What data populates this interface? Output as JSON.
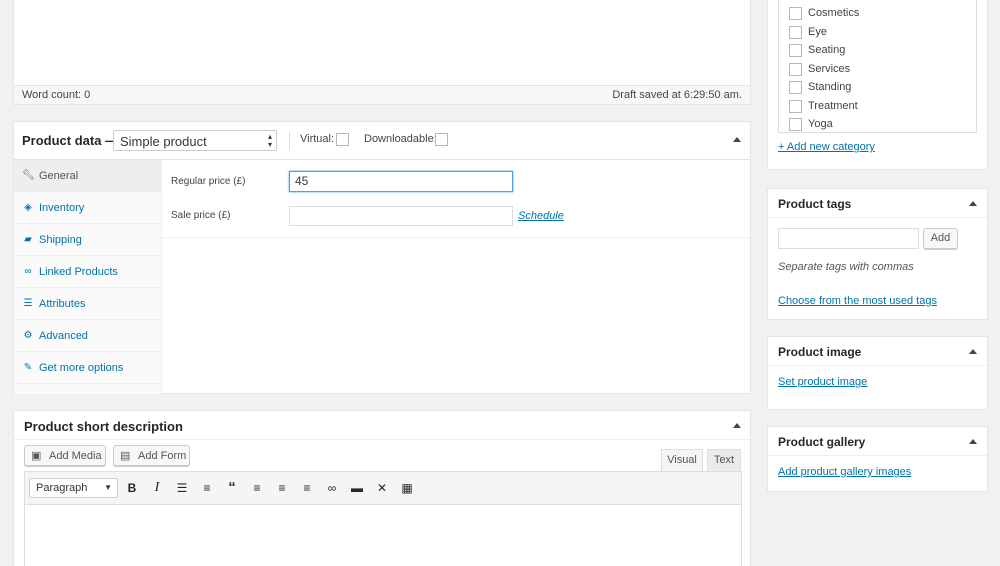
{
  "editor": {
    "word_count": "Word count: 0",
    "draft_saved": "Draft saved at 6:29:50 am."
  },
  "product_data": {
    "title": "Product data —",
    "type_select": "Simple product",
    "virtual_label": "Virtual:",
    "downloadable_label": "Downloadable:",
    "tabs": [
      {
        "label": "General",
        "icon": "wrench-icon"
      },
      {
        "label": "Inventory",
        "icon": "tag-icon"
      },
      {
        "label": "Shipping",
        "icon": "truck-icon"
      },
      {
        "label": "Linked Products",
        "icon": "link-icon"
      },
      {
        "label": "Attributes",
        "icon": "list-icon"
      },
      {
        "label": "Advanced",
        "icon": "gear-icon"
      },
      {
        "label": "Get more options",
        "icon": "plugin-icon"
      }
    ],
    "regular_price_label": "Regular price (£)",
    "regular_price_value": "45",
    "sale_price_label": "Sale price (£)",
    "sale_price_value": "",
    "schedule_link": "Schedule"
  },
  "short_description": {
    "title": "Product short description",
    "add_media": "Add Media",
    "add_form": "Add Form",
    "tab_visual": "Visual",
    "tab_text": "Text",
    "format_select": "Paragraph"
  },
  "categories": {
    "items": [
      "Cosmetics",
      "Eye",
      "Seating",
      "Services",
      "Standing",
      "Treatment",
      "Yoga"
    ],
    "add_new": "+ Add new category"
  },
  "tags": {
    "title": "Product tags",
    "add_button": "Add",
    "hint": "Separate tags with commas",
    "choose_link": "Choose from the most used tags"
  },
  "image": {
    "title": "Product image",
    "set_link": "Set product image"
  },
  "gallery": {
    "title": "Product gallery",
    "add_link": "Add product gallery images"
  }
}
